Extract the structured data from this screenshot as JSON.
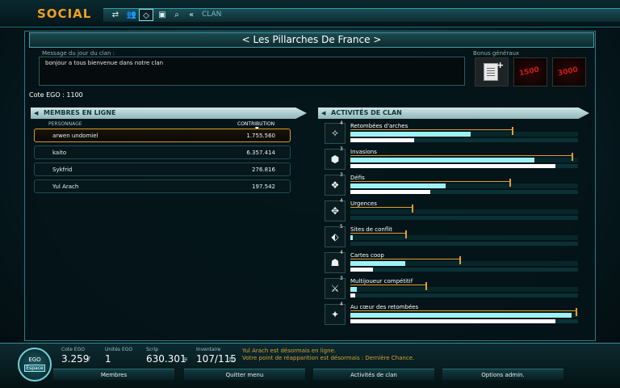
{
  "header": {
    "title": "SOCIAL",
    "breadcrumb": "CLAN",
    "nav_icons": [
      "arrows-icon",
      "group-icon",
      "diamond-icon",
      "chat-icon",
      "search-icon",
      "chevron-icon"
    ]
  },
  "clan": {
    "name": "< Les Pillarches De France >",
    "motd_label": "Message du jour du clan :",
    "motd": "bonjour a tous bienvenue dans notre clan",
    "bonus_label": "Bonus généraux",
    "bonuses": [
      "",
      "1500",
      "3000"
    ],
    "cote_ego": "Cote EGO : 1100"
  },
  "members": {
    "title": "MEMBRES EN LIGNE",
    "col_name": "PERSONNAGE",
    "col_contribution": "CONTRIBUTION",
    "rows": [
      {
        "name": "arwen undomiel",
        "value": "1.755.560"
      },
      {
        "name": "kaito",
        "value": "6.357.414"
      },
      {
        "name": "Sykfrid",
        "value": "276.816"
      },
      {
        "name": "Yul Arach",
        "value": "197.542"
      }
    ]
  },
  "activities": {
    "title": "ACTIVITÉS DE CLAN",
    "rows": [
      {
        "name": "Retombées d'arches",
        "level": "4",
        "fill": 0.53,
        "mark": 0.71,
        "sub": 0.28
      },
      {
        "name": "Invasions",
        "level": "3",
        "fill": 0.81,
        "mark": 0.97,
        "sub": 0.9
      },
      {
        "name": "Défis",
        "level": "3",
        "fill": 0.42,
        "mark": 0.7,
        "sub": 0.35
      },
      {
        "name": "Urgences",
        "level": "4",
        "fill": 0.0,
        "mark": 0.27,
        "sub": 0.0
      },
      {
        "name": "Sites de conflit",
        "level": "5",
        "fill": 0.01,
        "mark": 0.24,
        "sub": 0.0
      },
      {
        "name": "Cartes coop",
        "level": "4",
        "fill": 0.24,
        "mark": 0.48,
        "sub": 0.1
      },
      {
        "name": "Multijoueur compétitif",
        "level": "3",
        "fill": 0.03,
        "mark": 0.33,
        "sub": 0.02
      },
      {
        "name": "Au cœur des retombées",
        "level": "4",
        "fill": 0.97,
        "mark": 0.99,
        "sub": 0.9
      }
    ]
  },
  "footer": {
    "ego_line1": "EGO",
    "ego_line2": "Espace",
    "stats": [
      {
        "label": "Cote EGO",
        "value": "3.259",
        "icon": "?"
      },
      {
        "label": "Unités EGO",
        "value": "1",
        "icon": ""
      },
      {
        "label": "Scrip",
        "value": "630.301",
        "icon": "≋"
      },
      {
        "label": "Inventaire",
        "value": "107/115",
        "icon": "≣"
      }
    ],
    "notification1": "Yul Arach est désormais en ligne.",
    "notification2": "Votre point de réapparition est désormais : Dernière Chance.",
    "tabs": [
      "Membres",
      "Quitter menu",
      "Activités de clan",
      "Options admin."
    ]
  },
  "colors": {
    "accent": "#f0a020",
    "bar": "#9cf2f6",
    "marker": "#e0a030",
    "panel_border": "#2e7c84"
  }
}
